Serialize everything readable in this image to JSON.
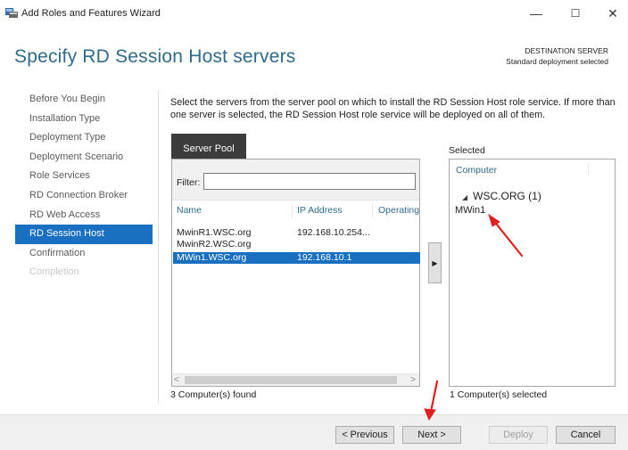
{
  "window": {
    "title": "Add Roles and Features Wizard",
    "icon": "server-manager-icon",
    "controls": {
      "minimize": "—",
      "maximize": "☐",
      "close": "✕"
    }
  },
  "header": {
    "title": "Specify RD Session Host servers",
    "destination_label": "DESTINATION SERVER",
    "destination_value": "Standard deployment selected"
  },
  "nav": {
    "items": [
      {
        "label": "Before You Begin",
        "state": "normal"
      },
      {
        "label": "Installation Type",
        "state": "normal"
      },
      {
        "label": "Deployment Type",
        "state": "normal"
      },
      {
        "label": "Deployment Scenario",
        "state": "normal"
      },
      {
        "label": "Role Services",
        "state": "normal"
      },
      {
        "label": "RD Connection Broker",
        "state": "normal"
      },
      {
        "label": "RD Web Access",
        "state": "normal"
      },
      {
        "label": "RD Session Host",
        "state": "active"
      },
      {
        "label": "Confirmation",
        "state": "normal"
      },
      {
        "label": "Completion",
        "state": "disabled"
      }
    ]
  },
  "description": "Select the servers from the server pool on which to install the RD Session Host role service. If more than one server is selected, the RD Session Host role service will be deployed on all of them.",
  "server_pool": {
    "tab_label": "Server Pool",
    "filter_label": "Filter:",
    "filter_value": "",
    "columns": [
      "Name",
      "IP Address",
      "Operating"
    ],
    "rows": [
      {
        "name": "MwinR1.WSC.org",
        "ip": "192.168.10.254...",
        "selected": false
      },
      {
        "name": "MwinR2.WSC.org",
        "ip": "",
        "selected": false
      },
      {
        "name": "MWin1.WSC.org",
        "ip": "192.168.10.1",
        "selected": true
      }
    ],
    "footer": "3 Computer(s) found",
    "scroll_left": "<",
    "scroll_right": ">"
  },
  "add_button": {
    "label": "▶"
  },
  "selected": {
    "label": "Selected",
    "column": "Computer",
    "group_toggle": "◢",
    "group": "WSC.ORG (1)",
    "items": [
      "MWin1"
    ],
    "footer": "1 Computer(s) selected"
  },
  "buttons": {
    "previous": "< Previous",
    "next": "Next >",
    "deploy": "Deploy",
    "cancel": "Cancel"
  },
  "colors": {
    "accent": "#1a70c0",
    "heading": "#2f6b8b",
    "annotation_arrow": "#e02020"
  }
}
